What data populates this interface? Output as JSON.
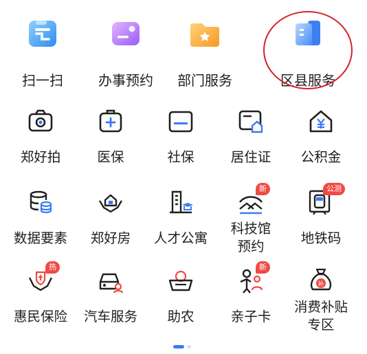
{
  "top": [
    {
      "label": "扫一扫",
      "icon": "scan-icon"
    },
    {
      "label": "办事预约",
      "icon": "appointment-card-icon"
    },
    {
      "label": "部门服务",
      "icon": "department-folder-icon"
    },
    {
      "label": "区县服务",
      "icon": "district-building-icon"
    }
  ],
  "grid": [
    {
      "label": "郑好拍",
      "icon": "camera-icon"
    },
    {
      "label": "医保",
      "icon": "medical-kit-icon"
    },
    {
      "label": "社保",
      "icon": "social-security-card-icon"
    },
    {
      "label": "居住证",
      "icon": "residence-permit-icon"
    },
    {
      "label": "公积金",
      "icon": "housing-fund-icon"
    },
    {
      "label": "数据要素",
      "icon": "database-icon"
    },
    {
      "label": "郑好房",
      "icon": "house-hands-icon"
    },
    {
      "label": "人才公寓",
      "icon": "talent-apartment-icon"
    },
    {
      "label": "科技馆预约",
      "line1": "科技馆",
      "line2": "预约",
      "icon": "science-museum-icon",
      "badge": "新"
    },
    {
      "label": "地铁码",
      "icon": "metro-icon",
      "badge": "公测"
    },
    {
      "label": "惠民保险",
      "icon": "insurance-hands-icon",
      "badge": "热"
    },
    {
      "label": "汽车服务",
      "icon": "car-service-icon"
    },
    {
      "label": "助农",
      "icon": "farm-basket-icon"
    },
    {
      "label": "亲子卡",
      "icon": "parent-child-icon",
      "badge": "新"
    },
    {
      "label": "消费补贴专区",
      "line1": "消费补贴",
      "line2": "专区",
      "icon": "money-bag-icon"
    }
  ],
  "colors": {
    "accent": "#3a7bf5",
    "badge": "#ef4a44",
    "annotation": "#d6202a",
    "text": "#1f1f1f"
  }
}
